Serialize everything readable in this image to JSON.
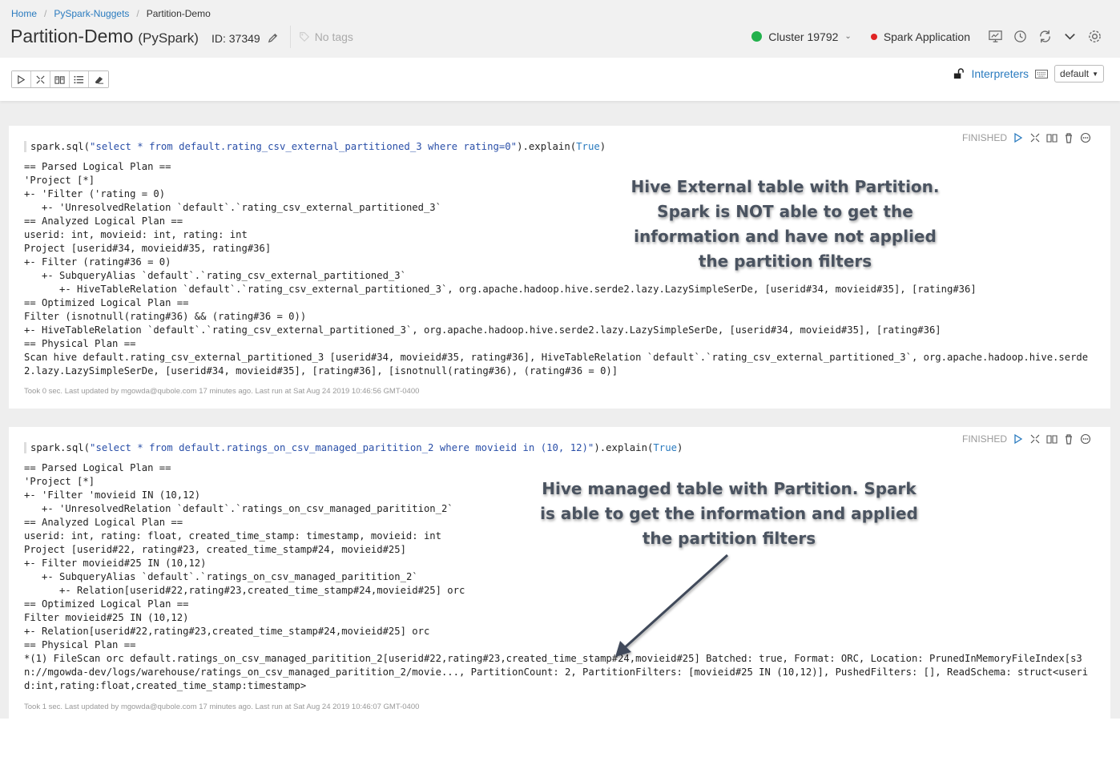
{
  "breadcrumb": {
    "home": "Home",
    "folder": "PySpark-Nuggets",
    "current": "Partition-Demo"
  },
  "notebook": {
    "name": "Partition-Demo",
    "language": "(PySpark)",
    "id_label": "ID: 37349",
    "tags_placeholder": "No tags"
  },
  "header": {
    "cluster_label": "Cluster 19792",
    "spark_app_label": "Spark Application",
    "cluster_status_color": "#22b14c",
    "spark_status_color": "#e02424"
  },
  "toolbar": {
    "interpreters_label": "Interpreters",
    "default_select": "default"
  },
  "paragraphs": [
    {
      "status": "FINISHED",
      "code_prefix": "spark.sql(",
      "code_string": "\"select * from default.rating_csv_external_partitioned_3 where rating=0\"",
      "code_mid": ").explain(",
      "code_kw": "True",
      "code_suffix": ")",
      "output": "== Parsed Logical Plan ==\n'Project [*]\n+- 'Filter ('rating = 0)\n   +- 'UnresolvedRelation `default`.`rating_csv_external_partitioned_3`\n== Analyzed Logical Plan ==\nuserid: int, movieid: int, rating: int\nProject [userid#34, movieid#35, rating#36]\n+- Filter (rating#36 = 0)\n   +- SubqueryAlias `default`.`rating_csv_external_partitioned_3`\n      +- HiveTableRelation `default`.`rating_csv_external_partitioned_3`, org.apache.hadoop.hive.serde2.lazy.LazySimpleSerDe, [userid#34, movieid#35], [rating#36]\n== Optimized Logical Plan ==\nFilter (isnotnull(rating#36) && (rating#36 = 0))\n+- HiveTableRelation `default`.`rating_csv_external_partitioned_3`, org.apache.hadoop.hive.serde2.lazy.LazySimpleSerDe, [userid#34, movieid#35], [rating#36]\n== Physical Plan ==\nScan hive default.rating_csv_external_partitioned_3 [userid#34, movieid#35, rating#36], HiveTableRelation `default`.`rating_csv_external_partitioned_3`, org.apache.hadoop.hive.serde2.lazy.LazySimpleSerDe, [userid#34, movieid#35], [rating#36], [isnotnull(rating#36), (rating#36 = 0)]",
      "footer": "Took 0 sec. Last updated by mgowda@qubole.com 17 minutes ago. Last run at Sat Aug 24 2019 10:46:56 GMT-0400",
      "annotation": "Hive External table with Partition. Spark is NOT able to get the information and have not applied the partition filters"
    },
    {
      "status": "FINISHED",
      "code_prefix": "spark.sql(",
      "code_string": "\"select * from default.ratings_on_csv_managed_paritition_2 where movieid in (10, 12)\"",
      "code_mid": ").explain(",
      "code_kw": "True",
      "code_suffix": ")",
      "output": "== Parsed Logical Plan ==\n'Project [*]\n+- 'Filter 'movieid IN (10,12)\n   +- 'UnresolvedRelation `default`.`ratings_on_csv_managed_paritition_2`\n== Analyzed Logical Plan ==\nuserid: int, rating: float, created_time_stamp: timestamp, movieid: int\nProject [userid#22, rating#23, created_time_stamp#24, movieid#25]\n+- Filter movieid#25 IN (10,12)\n   +- SubqueryAlias `default`.`ratings_on_csv_managed_paritition_2`\n      +- Relation[userid#22,rating#23,created_time_stamp#24,movieid#25] orc\n== Optimized Logical Plan ==\nFilter movieid#25 IN (10,12)\n+- Relation[userid#22,rating#23,created_time_stamp#24,movieid#25] orc\n== Physical Plan ==\n*(1) FileScan orc default.ratings_on_csv_managed_paritition_2[userid#22,rating#23,created_time_stamp#24,movieid#25] Batched: true, Format: ORC, Location: PrunedInMemoryFileIndex[s3n://mgowda-dev/logs/warehouse/ratings_on_csv_managed_paritition_2/movie..., PartitionCount: 2, PartitionFilters: [movieid#25 IN (10,12)], PushedFilters: [], ReadSchema: struct<userid:int,rating:float,created_time_stamp:timestamp>",
      "footer": "Took 1 sec. Last updated by mgowda@qubole.com 17 minutes ago. Last run at Sat Aug 24 2019 10:46:07 GMT-0400",
      "annotation": "Hive managed table with Partition. Spark is able to get the information and applied the partition filters"
    }
  ],
  "icons": {
    "edit": "pencil-icon",
    "tag": "tag-icon",
    "run": "play-icon",
    "hide_code": "collapse-icon",
    "hide_output": "book-icon",
    "list": "list-icon",
    "clear": "eraser-icon",
    "lock": "unlock-icon",
    "keyboard": "keyboard-icon"
  }
}
